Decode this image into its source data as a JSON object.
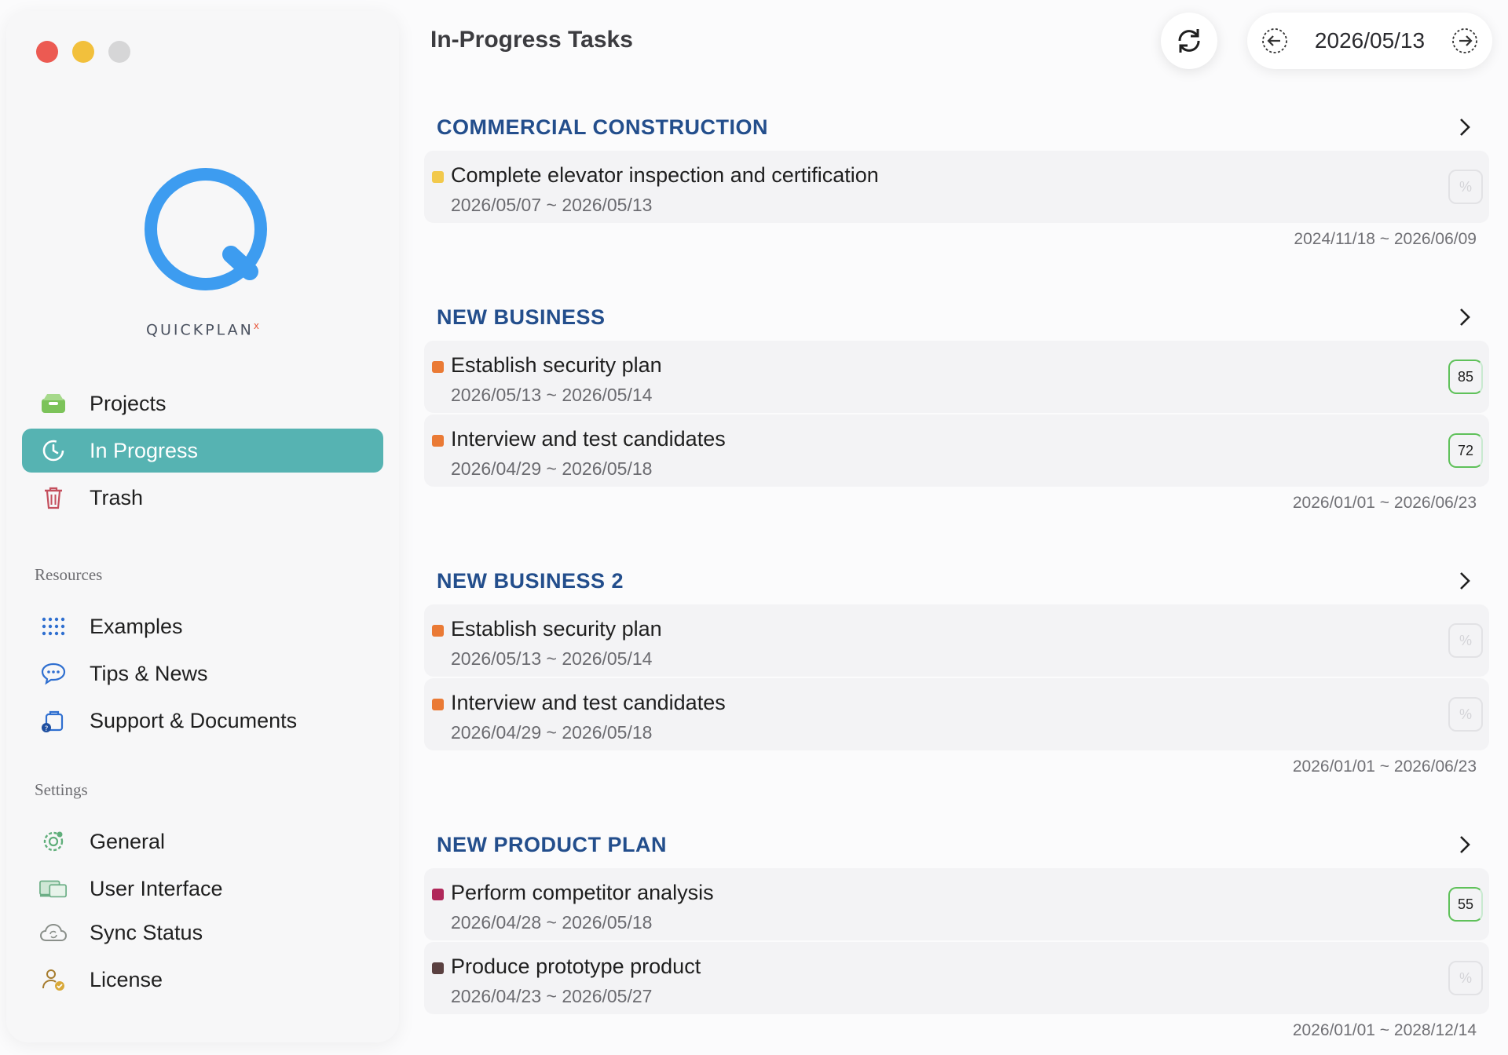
{
  "window": {
    "traffic_lights": [
      "close",
      "minimize",
      "zoom"
    ]
  },
  "brand": {
    "name": "QUICKPLAN",
    "mark": "x",
    "color": "#3d9cf0"
  },
  "sidebar": {
    "main_items": [
      {
        "label": "Projects",
        "icon": "tray-icon",
        "active": false
      },
      {
        "label": "In Progress",
        "icon": "clock-icon",
        "active": true
      },
      {
        "label": "Trash",
        "icon": "trash-icon",
        "active": false
      }
    ],
    "resources_label": "Resources",
    "resources_items": [
      {
        "label": "Examples",
        "icon": "grid-icon"
      },
      {
        "label": "Tips & News",
        "icon": "chat-bubble-icon"
      },
      {
        "label": "Support & Documents",
        "icon": "support-bag-icon"
      }
    ],
    "settings_label": "Settings",
    "settings_items": [
      {
        "label": "General",
        "icon": "gear-icon"
      },
      {
        "label": "User Interface",
        "icon": "display-icon"
      }
    ],
    "bottom_items": [
      {
        "label": "Sync Status",
        "icon": "cloud-sync-icon"
      },
      {
        "label": "License",
        "icon": "person-badge-icon"
      }
    ],
    "accent_color": "#56b3b2"
  },
  "header": {
    "title": "In-Progress Tasks",
    "date": "2026/05/13",
    "refresh_icon": "refresh-icon",
    "prev_icon": "arrow-left-circle-icon",
    "next_icon": "arrow-right-circle-icon"
  },
  "groups": [
    {
      "title": "COMMERCIAL CONSTRUCTION",
      "range": "2024/11/18 ~ 2026/06/09",
      "tasks": [
        {
          "name": "Complete elevator inspection and certification",
          "dates": "2026/05/07 ~ 2026/05/13",
          "color": "#f2c94c",
          "progress": "%"
        }
      ]
    },
    {
      "title": "NEW BUSINESS",
      "range": "2026/01/01 ~ 2026/06/23",
      "tasks": [
        {
          "name": "Establish security plan",
          "dates": "2026/05/13 ~ 2026/05/14",
          "color": "#ea7a35",
          "progress": "85"
        },
        {
          "name": "Interview and test candidates",
          "dates": "2026/04/29 ~ 2026/05/18",
          "color": "#ea7a35",
          "progress": "72"
        }
      ]
    },
    {
      "title": "NEW BUSINESS 2",
      "range": "2026/01/01 ~ 2026/06/23",
      "tasks": [
        {
          "name": "Establish security plan",
          "dates": "2026/05/13 ~ 2026/05/14",
          "color": "#ea7a35",
          "progress": "%"
        },
        {
          "name": "Interview and test candidates",
          "dates": "2026/04/29 ~ 2026/05/18",
          "color": "#ea7a35",
          "progress": "%"
        }
      ]
    },
    {
      "title": "NEW PRODUCT PLAN",
      "range": "2026/01/01 ~ 2028/12/14",
      "tasks": [
        {
          "name": "Perform competitor analysis",
          "dates": "2026/04/28 ~ 2026/05/18",
          "color": "#b0285a",
          "progress": "55"
        },
        {
          "name": "Produce prototype product",
          "dates": "2026/04/23 ~ 2026/05/27",
          "color": "#5a4040",
          "progress": "%"
        }
      ]
    }
  ]
}
